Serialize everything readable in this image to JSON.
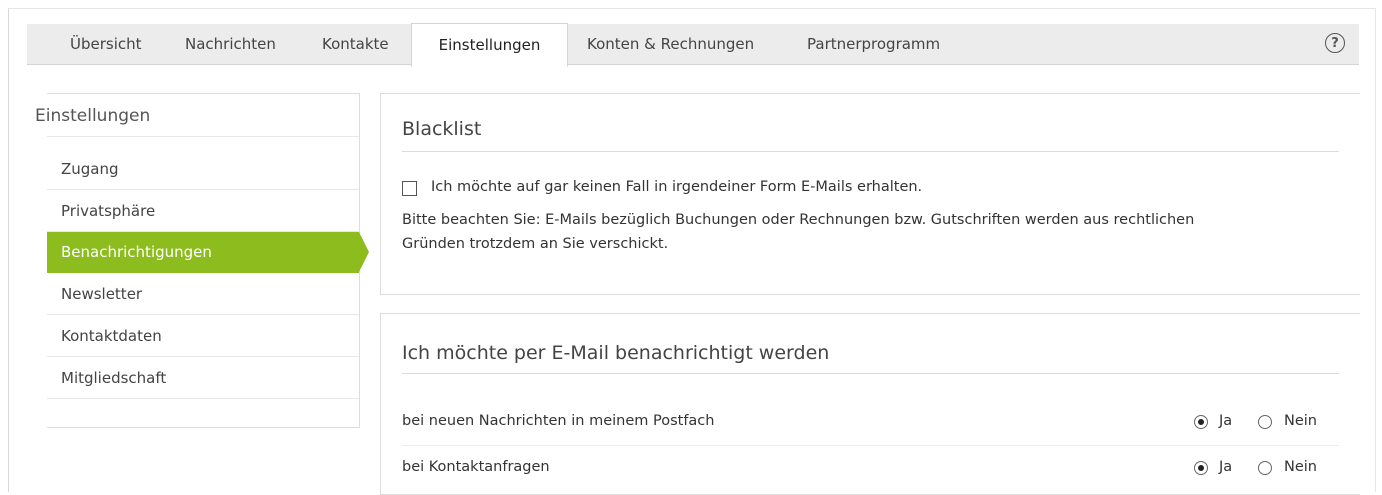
{
  "tabs": [
    {
      "label": "Übersicht",
      "active": false
    },
    {
      "label": "Nachrichten",
      "active": false
    },
    {
      "label": "Kontakte",
      "active": false
    },
    {
      "label": "Einstellungen",
      "active": true
    },
    {
      "label": "Konten & Rechnungen",
      "active": false
    },
    {
      "label": "Partnerprogramm",
      "active": false
    }
  ],
  "help_icon": {
    "symbol": "?"
  },
  "sidebar": {
    "title": "Einstellungen",
    "items": [
      {
        "label": "Zugang",
        "active": false
      },
      {
        "label": "Privatsphäre",
        "active": false
      },
      {
        "label": "Benachrichtigungen",
        "active": true
      },
      {
        "label": "Newsletter",
        "active": false
      },
      {
        "label": "Kontaktdaten",
        "active": false
      },
      {
        "label": "Mitgliedschaft",
        "active": false
      }
    ]
  },
  "blacklist": {
    "title": "Blacklist",
    "checkbox_label": "Ich möchte auf gar keinen Fall in irgendeiner Form E-Mails erhalten.",
    "checked": false,
    "note_line1": "Bitte beachten Sie: E-Mails bezüglich Buchungen oder Rechnungen bzw. Gutschriften werden aus rechtlichen",
    "note_line2": "Gründen trotzdem an Sie verschickt."
  },
  "notifications": {
    "title": "Ich möchte per E-Mail benachrichtigt werden",
    "yes_label": "Ja",
    "no_label": "Nein",
    "rows": [
      {
        "label": "bei neuen Nachrichten in meinem Postfach",
        "value": "Ja"
      },
      {
        "label": "bei Kontaktanfragen",
        "value": "Ja"
      }
    ]
  },
  "colors": {
    "accent": "#8cbc1d"
  }
}
